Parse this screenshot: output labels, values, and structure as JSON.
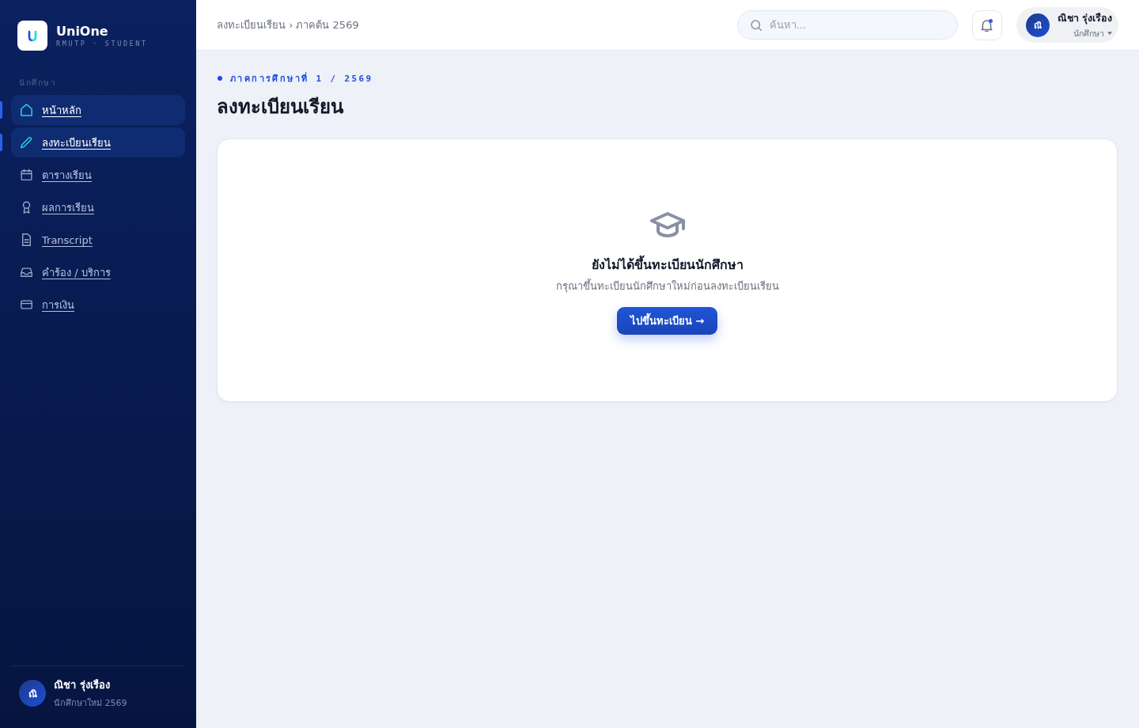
{
  "sidebar": {
    "brand": {
      "name": "UniOne",
      "subtitle": "RMUTP · STUDENT"
    },
    "section_label": "นักศึกษา",
    "items": [
      {
        "label": "หน้าหลัก",
        "selected": true
      },
      {
        "label": "ลงทะเบียนเรียน",
        "selected": true
      },
      {
        "label": "ตารางเรียน",
        "selected": false
      },
      {
        "label": "ผลการเรียน",
        "selected": false
      },
      {
        "label": "Transcript",
        "selected": false
      },
      {
        "label": "คำร้อง / บริการ",
        "selected": false
      },
      {
        "label": "การเงิน",
        "selected": false
      }
    ],
    "user": {
      "initials": "ณิ",
      "name": "ณิชา รุ่งเรือง",
      "role": "นักศึกษาใหม่ 2569"
    }
  },
  "topbar": {
    "breadcrumb": "ลงทะเบียนเรียน › ภาคต้น 2569",
    "search": {
      "placeholder": "ค้นหา..."
    },
    "notifications": {
      "unread": true
    },
    "user": {
      "initials": "ณิ",
      "name": "ณิชา รุ่งเรือง",
      "role": "นักศึกษา"
    }
  },
  "page": {
    "eyebrow": "ภาคการศึกษาที่ 1 / 2569",
    "title": "ลงทะเบียนเรียน"
  },
  "empty_state": {
    "title": "ยังไม่ได้ขึ้นทะเบียนนักศึกษา",
    "message": "กรุณาขึ้นทะเบียนนักศึกษาใหม่ก่อนลงทะเบียนเรียน",
    "button": "ไปขึ้นทะเบียน →"
  }
}
